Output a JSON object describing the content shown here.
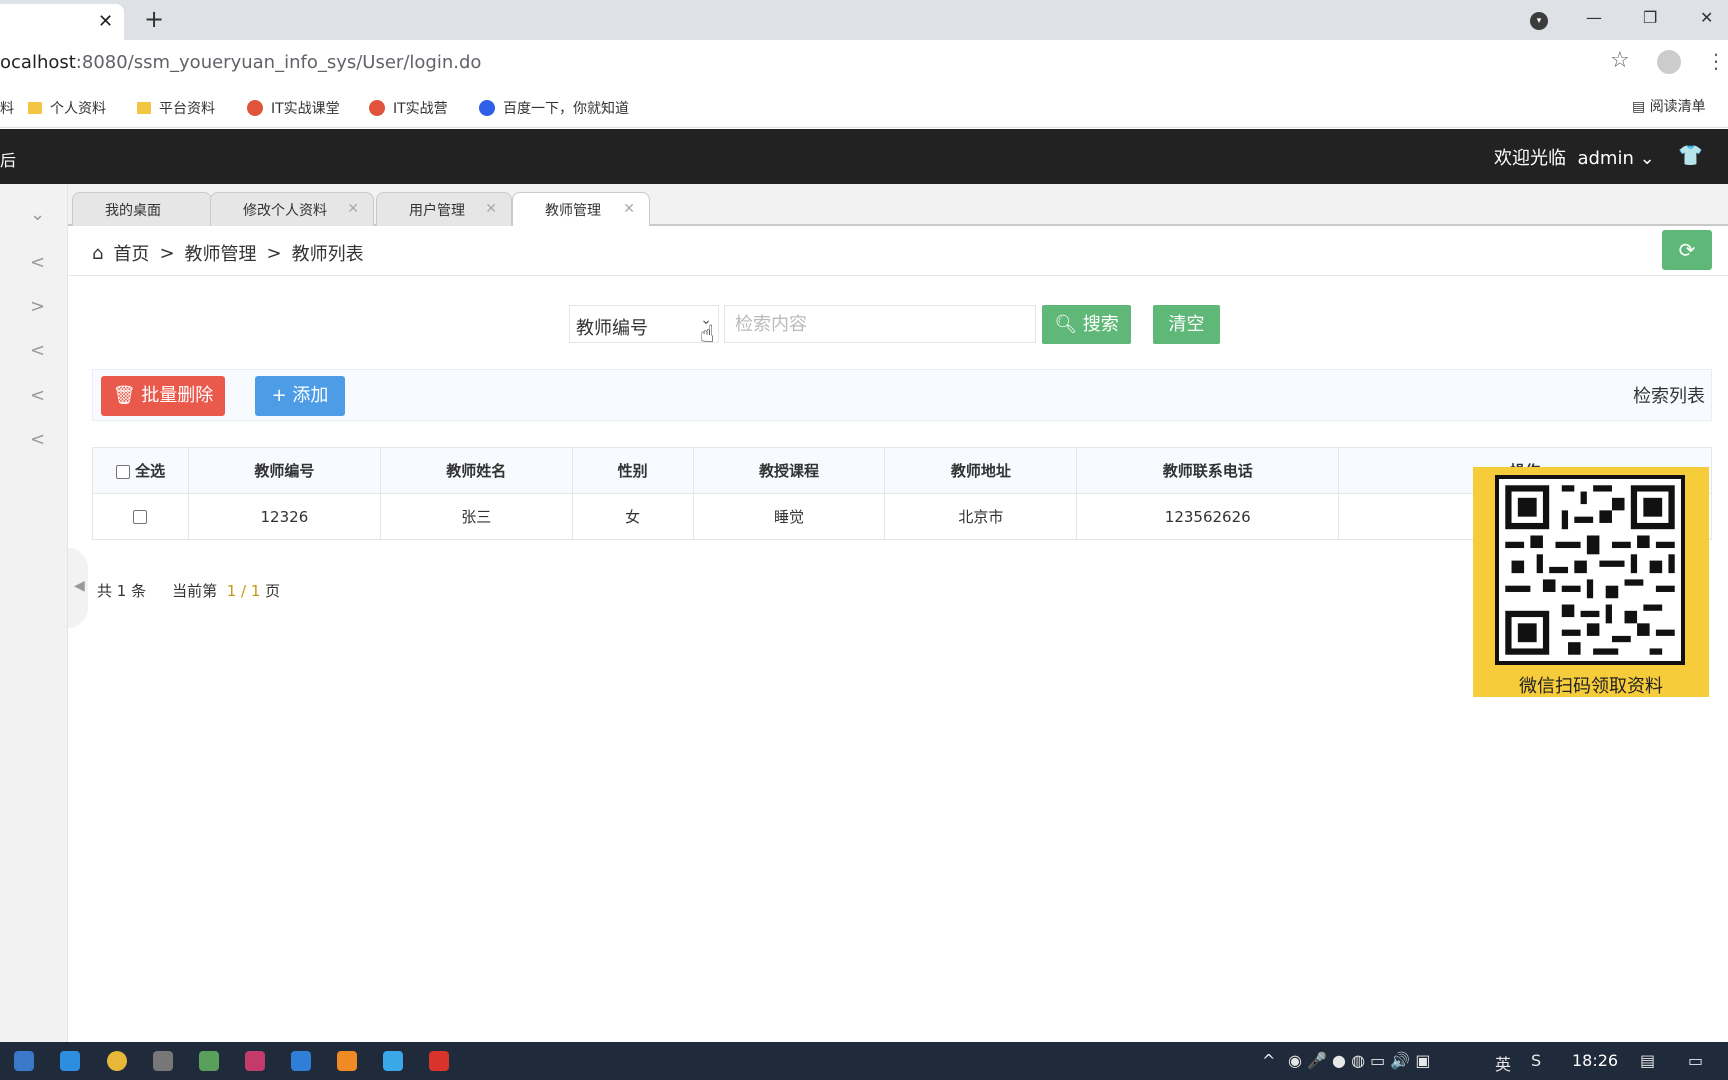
{
  "browser": {
    "tab_close": "✕",
    "new_tab": "+",
    "url_host": "ocalhost",
    "url_rest": ":8080/ssm_youeryuan_info_sys/User/login.do",
    "bookmarks": [
      {
        "label": "料",
        "icon": "folder"
      },
      {
        "label": "个人资料",
        "icon": "folder"
      },
      {
        "label": "平台资料",
        "icon": "folder"
      },
      {
        "label": "IT实战课堂",
        "icon": "red-circle"
      },
      {
        "label": "IT实战营",
        "icon": "red-circle"
      },
      {
        "label": "百度一下，你就知道",
        "icon": "baidu-paw"
      }
    ],
    "reading_list": "阅读清单"
  },
  "header": {
    "edge_text": "后",
    "welcome": "欢迎光临",
    "user": "admin"
  },
  "tabs": [
    {
      "label": "我的桌面",
      "closable": false
    },
    {
      "label": "修改个人资料",
      "closable": true
    },
    {
      "label": "用户管理",
      "closable": true
    },
    {
      "label": "教师管理",
      "closable": true,
      "active": true
    }
  ],
  "breadcrumb": {
    "home": "首页",
    "sep": ">",
    "level1": "教师管理",
    "level2": "教师列表"
  },
  "search": {
    "field_selected": "教师编号",
    "placeholder": "检索内容",
    "search_label": "搜索",
    "clear_label": "清空"
  },
  "toolbar": {
    "batch_delete": "批量删除",
    "add": "添加",
    "list_title": "检索列表"
  },
  "table": {
    "select_all": "全选",
    "columns": [
      "教师编号",
      "教师姓名",
      "性别",
      "教授课程",
      "教师地址",
      "教师联系电话",
      "操作"
    ],
    "rows": [
      {
        "id": "12326",
        "name": "张三",
        "gender": "女",
        "course": "睡觉",
        "address": "北京市",
        "phone": "123562626"
      }
    ]
  },
  "pager": {
    "total_prefix": "共",
    "total": "1",
    "total_suffix": "条",
    "current_prefix": "当前第",
    "current": "1 / 1",
    "current_suffix": "页"
  },
  "overlay": {
    "caption": "微信扫码领取资料"
  },
  "taskbar": {
    "ime": "英",
    "clock": "18:26"
  }
}
